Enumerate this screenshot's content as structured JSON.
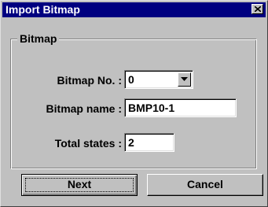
{
  "window": {
    "title": "Import Bitmap",
    "close_symbol": "close-icon"
  },
  "group": {
    "legend": "Bitmap"
  },
  "fields": {
    "bitmap_no": {
      "label": "Bitmap No. :",
      "value": "0"
    },
    "bitmap_name": {
      "label": "Bitmap name :",
      "value": "BMP10-1"
    },
    "total_states": {
      "label": "Total states :",
      "value": "2"
    }
  },
  "buttons": {
    "next": "Next",
    "cancel": "Cancel"
  },
  "colors": {
    "title_bar": "#000080",
    "face": "#c0c0c0",
    "field_bg": "#ffffff"
  }
}
